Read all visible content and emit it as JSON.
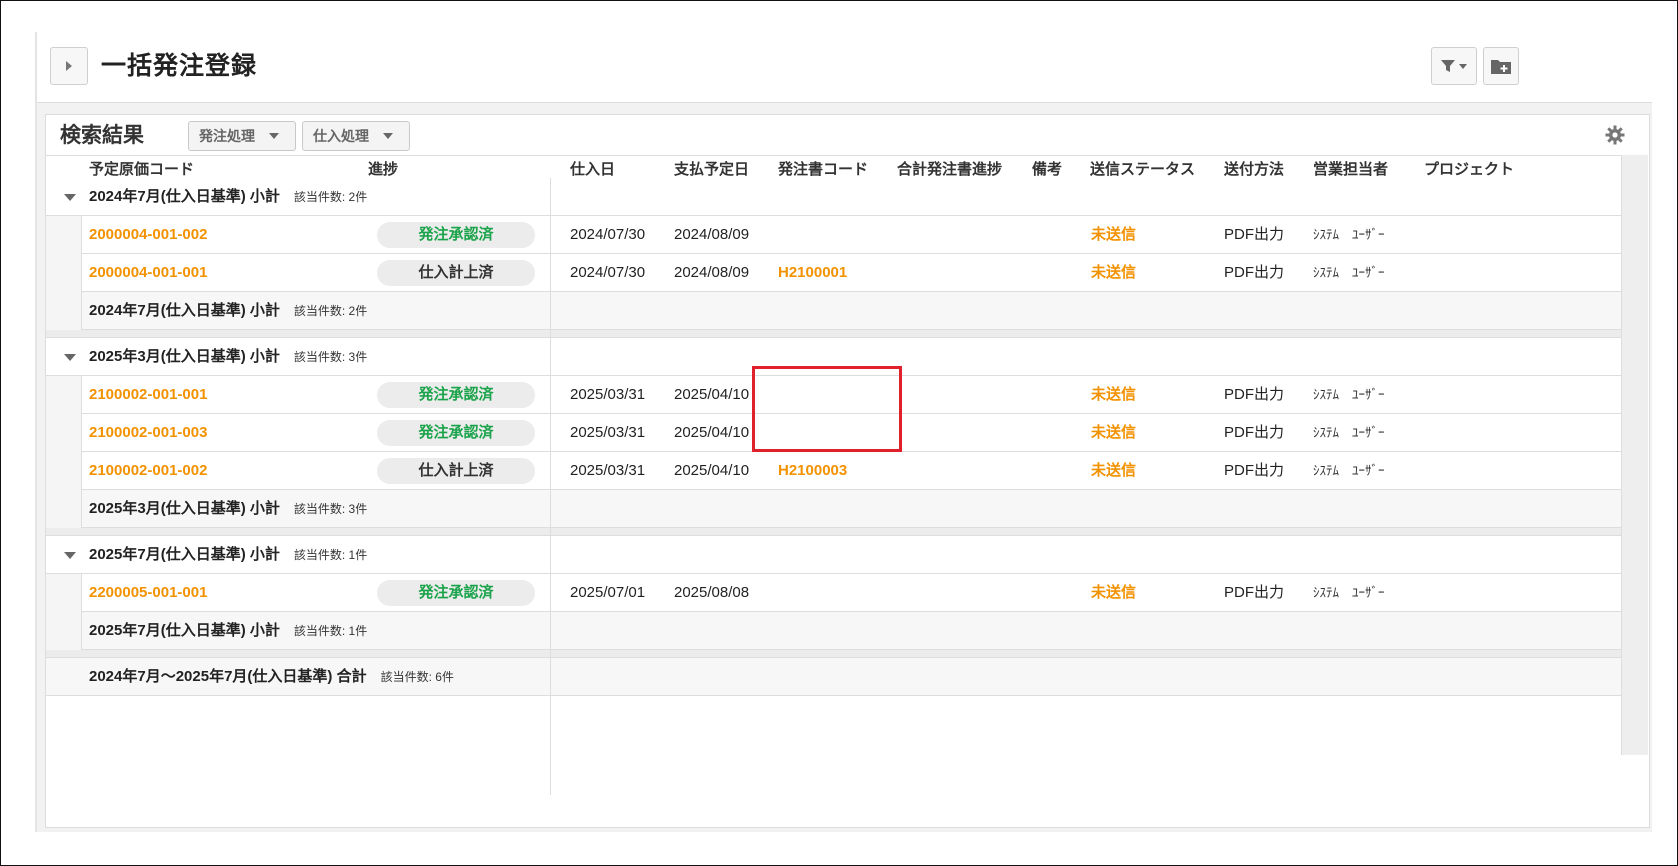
{
  "page": {
    "title": "一括発注登録"
  },
  "panel": {
    "title": "検索結果",
    "actions": [
      {
        "label": "発注処理"
      },
      {
        "label": "仕入処理"
      }
    ]
  },
  "columns": {
    "code": "予定原価コード",
    "progress": "進捗",
    "purchase_date": "仕入日",
    "payment_date": "支払予定日",
    "po_code": "発注書コード",
    "total_po_progress": "合計発注書進捗",
    "notes": "備考",
    "send_status": "送信ステータス",
    "send_method": "送付方法",
    "sales_rep": "営業担当者",
    "project": "プロジェクト"
  },
  "groups": [
    {
      "label": "2024年7月(仕入日基準) 小計",
      "count": "該当件数: 2件",
      "rows": [
        {
          "code": "2000004-001-002",
          "progress": "発注承認済",
          "progress_type": "green",
          "purchase_date": "2024/07/30",
          "payment_date": "2024/08/09",
          "po_code": "",
          "send_status": "未送信",
          "send_method": "PDF出力",
          "sales_rep": "ｼｽﾃﾑ　ﾕｰｻﾞｰ"
        },
        {
          "code": "2000004-001-001",
          "progress": "仕入計上済",
          "progress_type": "dark",
          "purchase_date": "2024/07/30",
          "payment_date": "2024/08/09",
          "po_code": "H2100001",
          "send_status": "未送信",
          "send_method": "PDF出力",
          "sales_rep": "ｼｽﾃﾑ　ﾕｰｻﾞｰ"
        }
      ]
    },
    {
      "label": "2025年3月(仕入日基準) 小計",
      "count": "該当件数: 3件",
      "rows": [
        {
          "code": "2100002-001-001",
          "progress": "発注承認済",
          "progress_type": "green",
          "purchase_date": "2025/03/31",
          "payment_date": "2025/04/10",
          "po_code": "",
          "send_status": "未送信",
          "send_method": "PDF出力",
          "sales_rep": "ｼｽﾃﾑ　ﾕｰｻﾞｰ"
        },
        {
          "code": "2100002-001-003",
          "progress": "発注承認済",
          "progress_type": "green",
          "purchase_date": "2025/03/31",
          "payment_date": "2025/04/10",
          "po_code": "",
          "send_status": "未送信",
          "send_method": "PDF出力",
          "sales_rep": "ｼｽﾃﾑ　ﾕｰｻﾞｰ"
        },
        {
          "code": "2100002-001-002",
          "progress": "仕入計上済",
          "progress_type": "dark",
          "purchase_date": "2025/03/31",
          "payment_date": "2025/04/10",
          "po_code": "H2100003",
          "send_status": "未送信",
          "send_method": "PDF出力",
          "sales_rep": "ｼｽﾃﾑ　ﾕｰｻﾞｰ"
        }
      ]
    },
    {
      "label": "2025年7月(仕入日基準) 小計",
      "count": "該当件数: 1件",
      "rows": [
        {
          "code": "2200005-001-001",
          "progress": "発注承認済",
          "progress_type": "green",
          "purchase_date": "2025/07/01",
          "payment_date": "2025/08/08",
          "po_code": "",
          "send_status": "未送信",
          "send_method": "PDF出力",
          "sales_rep": "ｼｽﾃﾑ　ﾕｰｻﾞｰ"
        }
      ]
    }
  ],
  "grand_total": {
    "label": "2024年7月～2025年7月(仕入日基準) 合計",
    "count": "該当件数: 6件"
  },
  "colors": {
    "orange": "#f39200",
    "green": "#1aa34a",
    "highlight": "#e0202a"
  },
  "icons": {
    "toggle": "caret-right-icon",
    "filter": "filter-icon",
    "add_folder": "folder-plus-icon",
    "settings": "gear-icon"
  }
}
